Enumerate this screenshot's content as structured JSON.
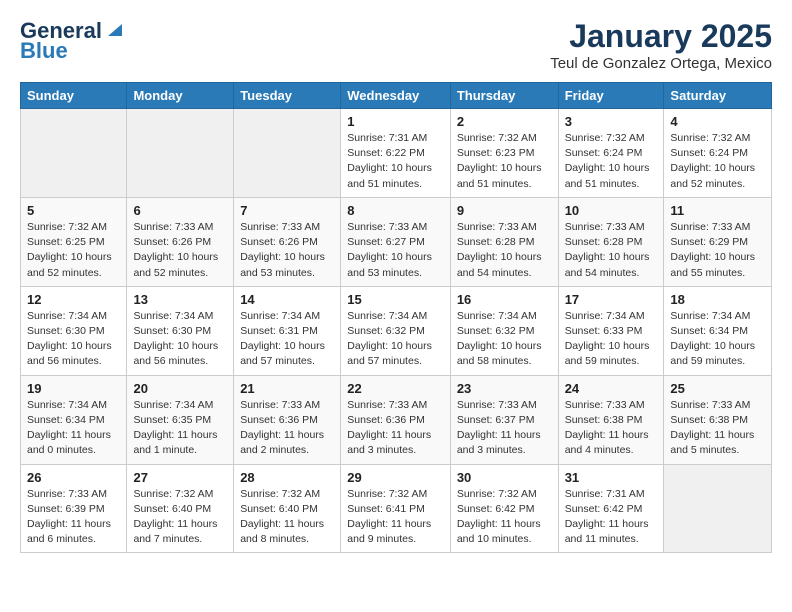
{
  "header": {
    "logo_line1": "General",
    "logo_line2": "Blue",
    "title": "January 2025",
    "subtitle": "Teul de Gonzalez Ortega, Mexico"
  },
  "weekdays": [
    "Sunday",
    "Monday",
    "Tuesday",
    "Wednesday",
    "Thursday",
    "Friday",
    "Saturday"
  ],
  "weeks": [
    [
      {
        "day": "",
        "empty": true
      },
      {
        "day": "",
        "empty": true
      },
      {
        "day": "",
        "empty": true
      },
      {
        "day": "1",
        "sunrise": "Sunrise: 7:31 AM",
        "sunset": "Sunset: 6:22 PM",
        "daylight": "Daylight: 10 hours and 51 minutes."
      },
      {
        "day": "2",
        "sunrise": "Sunrise: 7:32 AM",
        "sunset": "Sunset: 6:23 PM",
        "daylight": "Daylight: 10 hours and 51 minutes."
      },
      {
        "day": "3",
        "sunrise": "Sunrise: 7:32 AM",
        "sunset": "Sunset: 6:24 PM",
        "daylight": "Daylight: 10 hours and 51 minutes."
      },
      {
        "day": "4",
        "sunrise": "Sunrise: 7:32 AM",
        "sunset": "Sunset: 6:24 PM",
        "daylight": "Daylight: 10 hours and 52 minutes."
      }
    ],
    [
      {
        "day": "5",
        "sunrise": "Sunrise: 7:32 AM",
        "sunset": "Sunset: 6:25 PM",
        "daylight": "Daylight: 10 hours and 52 minutes."
      },
      {
        "day": "6",
        "sunrise": "Sunrise: 7:33 AM",
        "sunset": "Sunset: 6:26 PM",
        "daylight": "Daylight: 10 hours and 52 minutes."
      },
      {
        "day": "7",
        "sunrise": "Sunrise: 7:33 AM",
        "sunset": "Sunset: 6:26 PM",
        "daylight": "Daylight: 10 hours and 53 minutes."
      },
      {
        "day": "8",
        "sunrise": "Sunrise: 7:33 AM",
        "sunset": "Sunset: 6:27 PM",
        "daylight": "Daylight: 10 hours and 53 minutes."
      },
      {
        "day": "9",
        "sunrise": "Sunrise: 7:33 AM",
        "sunset": "Sunset: 6:28 PM",
        "daylight": "Daylight: 10 hours and 54 minutes."
      },
      {
        "day": "10",
        "sunrise": "Sunrise: 7:33 AM",
        "sunset": "Sunset: 6:28 PM",
        "daylight": "Daylight: 10 hours and 54 minutes."
      },
      {
        "day": "11",
        "sunrise": "Sunrise: 7:33 AM",
        "sunset": "Sunset: 6:29 PM",
        "daylight": "Daylight: 10 hours and 55 minutes."
      }
    ],
    [
      {
        "day": "12",
        "sunrise": "Sunrise: 7:34 AM",
        "sunset": "Sunset: 6:30 PM",
        "daylight": "Daylight: 10 hours and 56 minutes."
      },
      {
        "day": "13",
        "sunrise": "Sunrise: 7:34 AM",
        "sunset": "Sunset: 6:30 PM",
        "daylight": "Daylight: 10 hours and 56 minutes."
      },
      {
        "day": "14",
        "sunrise": "Sunrise: 7:34 AM",
        "sunset": "Sunset: 6:31 PM",
        "daylight": "Daylight: 10 hours and 57 minutes."
      },
      {
        "day": "15",
        "sunrise": "Sunrise: 7:34 AM",
        "sunset": "Sunset: 6:32 PM",
        "daylight": "Daylight: 10 hours and 57 minutes."
      },
      {
        "day": "16",
        "sunrise": "Sunrise: 7:34 AM",
        "sunset": "Sunset: 6:32 PM",
        "daylight": "Daylight: 10 hours and 58 minutes."
      },
      {
        "day": "17",
        "sunrise": "Sunrise: 7:34 AM",
        "sunset": "Sunset: 6:33 PM",
        "daylight": "Daylight: 10 hours and 59 minutes."
      },
      {
        "day": "18",
        "sunrise": "Sunrise: 7:34 AM",
        "sunset": "Sunset: 6:34 PM",
        "daylight": "Daylight: 10 hours and 59 minutes."
      }
    ],
    [
      {
        "day": "19",
        "sunrise": "Sunrise: 7:34 AM",
        "sunset": "Sunset: 6:34 PM",
        "daylight": "Daylight: 11 hours and 0 minutes."
      },
      {
        "day": "20",
        "sunrise": "Sunrise: 7:34 AM",
        "sunset": "Sunset: 6:35 PM",
        "daylight": "Daylight: 11 hours and 1 minute."
      },
      {
        "day": "21",
        "sunrise": "Sunrise: 7:33 AM",
        "sunset": "Sunset: 6:36 PM",
        "daylight": "Daylight: 11 hours and 2 minutes."
      },
      {
        "day": "22",
        "sunrise": "Sunrise: 7:33 AM",
        "sunset": "Sunset: 6:36 PM",
        "daylight": "Daylight: 11 hours and 3 minutes."
      },
      {
        "day": "23",
        "sunrise": "Sunrise: 7:33 AM",
        "sunset": "Sunset: 6:37 PM",
        "daylight": "Daylight: 11 hours and 3 minutes."
      },
      {
        "day": "24",
        "sunrise": "Sunrise: 7:33 AM",
        "sunset": "Sunset: 6:38 PM",
        "daylight": "Daylight: 11 hours and 4 minutes."
      },
      {
        "day": "25",
        "sunrise": "Sunrise: 7:33 AM",
        "sunset": "Sunset: 6:38 PM",
        "daylight": "Daylight: 11 hours and 5 minutes."
      }
    ],
    [
      {
        "day": "26",
        "sunrise": "Sunrise: 7:33 AM",
        "sunset": "Sunset: 6:39 PM",
        "daylight": "Daylight: 11 hours and 6 minutes."
      },
      {
        "day": "27",
        "sunrise": "Sunrise: 7:32 AM",
        "sunset": "Sunset: 6:40 PM",
        "daylight": "Daylight: 11 hours and 7 minutes."
      },
      {
        "day": "28",
        "sunrise": "Sunrise: 7:32 AM",
        "sunset": "Sunset: 6:40 PM",
        "daylight": "Daylight: 11 hours and 8 minutes."
      },
      {
        "day": "29",
        "sunrise": "Sunrise: 7:32 AM",
        "sunset": "Sunset: 6:41 PM",
        "daylight": "Daylight: 11 hours and 9 minutes."
      },
      {
        "day": "30",
        "sunrise": "Sunrise: 7:32 AM",
        "sunset": "Sunset: 6:42 PM",
        "daylight": "Daylight: 11 hours and 10 minutes."
      },
      {
        "day": "31",
        "sunrise": "Sunrise: 7:31 AM",
        "sunset": "Sunset: 6:42 PM",
        "daylight": "Daylight: 11 hours and 11 minutes."
      },
      {
        "day": "",
        "empty": true
      }
    ]
  ]
}
